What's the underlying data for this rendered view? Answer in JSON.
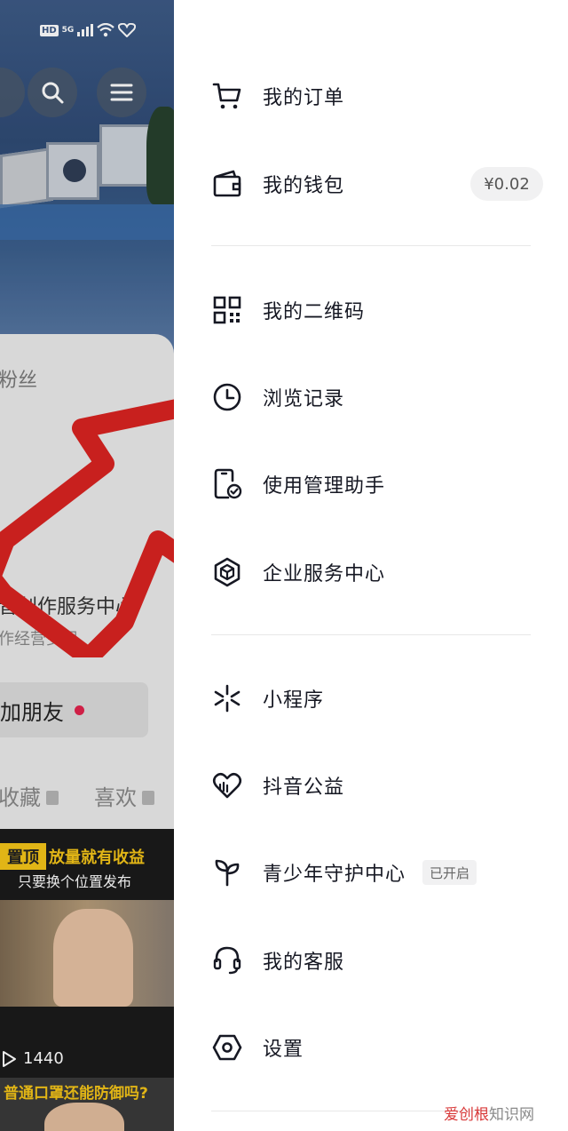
{
  "status_bar": {
    "hd": "HD",
    "network": "5G"
  },
  "background": {
    "fans_label": "粉丝",
    "creator_title": "音创作服务中心",
    "creator_subtitle": "作经营变现",
    "add_friend": "加朋友",
    "tabs": {
      "favorites": "收藏",
      "likes": "喜欢"
    },
    "video_1": {
      "pin": "置顶",
      "title": "放量就有收益",
      "subtitle": "只要换个位置发布",
      "views": "1440"
    },
    "video_2": {
      "title": "普通口罩还能防御吗?"
    }
  },
  "drawer": {
    "items": [
      {
        "label": "我的订单",
        "icon": "cart-icon"
      },
      {
        "label": "我的钱包",
        "icon": "wallet-icon",
        "badge": "¥0.02"
      },
      {
        "label": "我的二维码",
        "icon": "qrcode-icon"
      },
      {
        "label": "浏览记录",
        "icon": "clock-icon"
      },
      {
        "label": "使用管理助手",
        "icon": "phone-check-icon"
      },
      {
        "label": "企业服务中心",
        "icon": "enterprise-cube-icon"
      },
      {
        "label": "小程序",
        "icon": "mini-program-icon"
      },
      {
        "label": "抖音公益",
        "icon": "heart-charity-icon"
      },
      {
        "label": "青少年守护中心",
        "icon": "sprout-icon",
        "badge": "已开启"
      },
      {
        "label": "我的客服",
        "icon": "headset-icon"
      },
      {
        "label": "设置",
        "icon": "settings-hexagon-icon"
      }
    ]
  },
  "watermark": {
    "brand": "爱创根",
    "suffix": "知识网"
  },
  "colors": {
    "arrow": "#c8201e",
    "accent_red": "#e1234c",
    "pin_yellow": "#f5c518"
  }
}
